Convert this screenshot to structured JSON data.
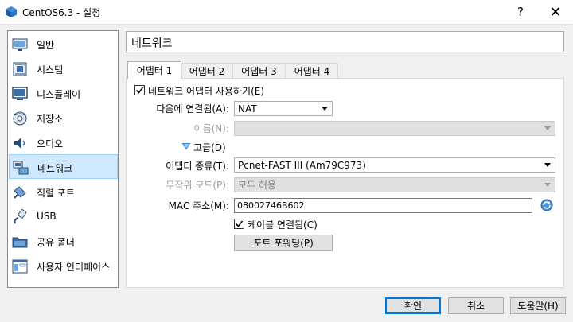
{
  "window": {
    "title": "CentOS6.3 - 설정",
    "help_glyph": "?",
    "close_glyph": "✕"
  },
  "sidebar": {
    "items": [
      {
        "label": "일반",
        "icon": "monitor-icon"
      },
      {
        "label": "시스템",
        "icon": "chip-icon"
      },
      {
        "label": "디스플레이",
        "icon": "display-icon"
      },
      {
        "label": "저장소",
        "icon": "disk-icon"
      },
      {
        "label": "오디오",
        "icon": "speaker-icon"
      },
      {
        "label": "네트워크",
        "icon": "network-icon",
        "selected": true
      },
      {
        "label": "직렬 포트",
        "icon": "serial-port-icon"
      },
      {
        "label": "USB",
        "icon": "usb-icon"
      },
      {
        "label": "공유 폴더",
        "icon": "folder-icon"
      },
      {
        "label": "사용자 인터페이스",
        "icon": "ui-icon"
      }
    ]
  },
  "section": {
    "title": "네트워크"
  },
  "tabs": [
    {
      "label": "어댑터 1",
      "active": true
    },
    {
      "label": "어댑터 2"
    },
    {
      "label": "어댑터 3"
    },
    {
      "label": "어댑터 4"
    }
  ],
  "form": {
    "enable_adapter": {
      "label": "네트워크 어댑터 사용하기(E)",
      "checked": true
    },
    "attached_to": {
      "label": "다음에 연결됨(A):",
      "value": "NAT"
    },
    "name": {
      "label": "이름(N):",
      "value": ""
    },
    "advanced": {
      "label": "고급(D)"
    },
    "adapter_type": {
      "label": "어댑터 종류(T):",
      "value": "Pcnet-FAST III (Am79C973)"
    },
    "promiscuous": {
      "label": "무작위 모드(P):",
      "value": "모두 허용"
    },
    "mac": {
      "label": "MAC 주소(M):",
      "value": "08002746B602"
    },
    "cable": {
      "label": "케이블 연결됨(C)",
      "checked": true
    },
    "port_forwarding": {
      "label": "포트 포워딩(P)"
    }
  },
  "buttons": {
    "ok": "확인",
    "cancel": "취소",
    "help": "도움말(H)"
  },
  "colors": {
    "selection": "#cde8ff",
    "accent": "#0078d7",
    "disabled": "#9d9d9d"
  }
}
